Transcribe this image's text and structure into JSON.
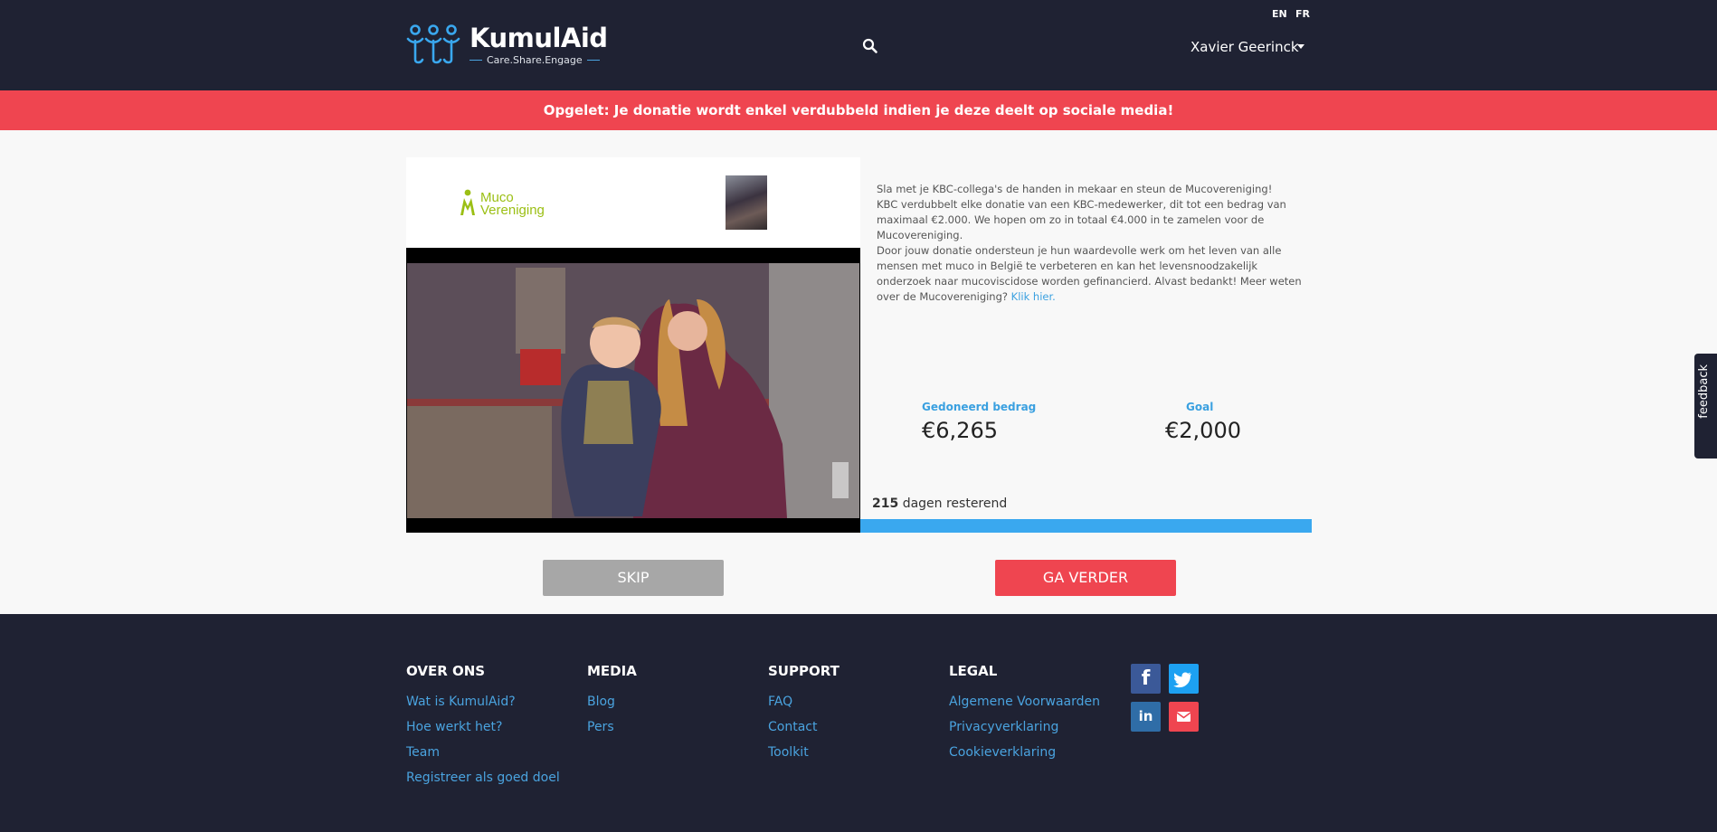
{
  "header": {
    "brand": "KumulAid",
    "tagline": "Care.Share.Engage",
    "languages": [
      "EN",
      "FR"
    ],
    "user_name": "Xavier Geerinck"
  },
  "alert": {
    "text": "Opgelet: Je donatie wordt enkel verdubbeld indien je deze deelt op sociale media!"
  },
  "campaign": {
    "partner_logo_text": [
      "Muco",
      "Vereniging"
    ],
    "description": [
      "Sla met je KBC-collega's de handen in mekaar en steun de Mucovereniging!",
      "KBC verdubbelt elke donatie van een KBC-medewerker, dit tot een bedrag van maximaal €2.000. We hopen om zo in totaal €4.000 in te zamelen voor de Mucovereniging.",
      "Door jouw donatie ondersteun je hun waardevolle werk om het leven van alle mensen met muco in België te verbeteren en kan het levensnoodzakelijk onderzoek naar mucoviscidose worden gefinancierd. Alvast bedankt! Meer weten over de Mucovereniging?"
    ],
    "link_text": "Klik hier.",
    "donated_label": "Gedoneerd bedrag",
    "donated_value": "€6,265",
    "goal_label": "Goal",
    "goal_value": "€2,000",
    "days_number": "215",
    "days_text": "dagen resterend",
    "progress_percent": 100
  },
  "buttons": {
    "skip": "SKIP",
    "next": "GA VERDER"
  },
  "footer": {
    "columns": [
      {
        "title": "OVER ONS",
        "links": [
          "Wat is KumulAid?",
          "Hoe werkt het?",
          "Team",
          "Registreer als goed doel"
        ]
      },
      {
        "title": "MEDIA",
        "links": [
          "Blog",
          "Pers"
        ]
      },
      {
        "title": "SUPPORT",
        "links": [
          "FAQ",
          "Contact",
          "Toolkit"
        ]
      },
      {
        "title": "LEGAL",
        "links": [
          "Algemene Voorwaarden",
          "Privacyverklaring",
          "Cookieverklaring"
        ]
      }
    ],
    "social": [
      "facebook-icon",
      "twitter-icon",
      "linkedin-icon",
      "mail-icon"
    ]
  },
  "feedback_label": "feedback",
  "colors": {
    "navy": "#1f2233",
    "accent_red": "#ef4550",
    "accent_blue": "#3aa8ef"
  }
}
